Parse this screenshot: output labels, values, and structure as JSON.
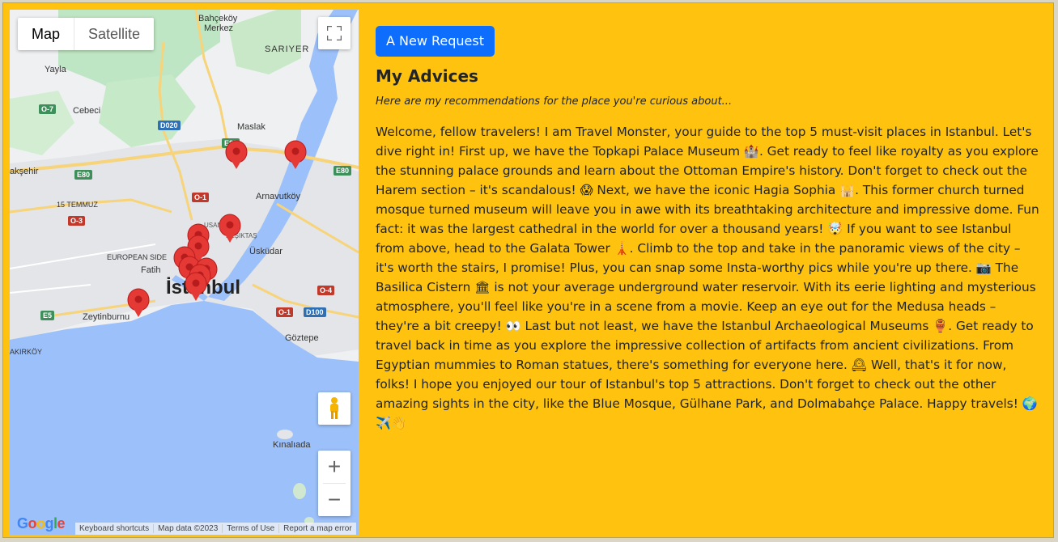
{
  "map": {
    "type_control": {
      "map_label": "Map",
      "satellite_label": "Satellite"
    },
    "fullscreen_icon": "fullscreen-icon",
    "pegman_icon": "pegman-icon",
    "zoom_in_label": "+",
    "zoom_out_label": "−",
    "google_logo": "Google",
    "attribution": {
      "shortcuts": "Keyboard shortcuts",
      "map_data": "Map data ©2023",
      "terms": "Terms of Use",
      "report": "Report a map error"
    },
    "labels": {
      "bahcekoy": "Bahçeköy",
      "merkez": "Merkez",
      "sariyer": "SARIYER",
      "yayla": "Yayla",
      "cebeci": "Cebeci",
      "maslak": "Maslak",
      "aksehir": "akşehir",
      "temmuz": "15 TEMMUZ",
      "arnavutkoy": "Arnavutköy",
      "european_side": "EUROPEAN SIDE",
      "fatih": "Fatih",
      "besiktas": "BEŞIKTAŞ",
      "uskudar": "Üsküdar",
      "istanbul": "İstanbul",
      "zeytinburnu": "Zeytinburnu",
      "goztepe": "Göztepe",
      "bakirkoy": "AKIRKÖY",
      "kinaliada": "Kınalıada",
      "usan": "USAN"
    },
    "shields": {
      "o7": "O-7",
      "d020": "D020",
      "e80a": "E80",
      "e80b": "E80",
      "e80c": "E80",
      "o1a": "O-1",
      "o3": "O-3",
      "e5": "E5",
      "o1b": "O-1",
      "d100": "D100",
      "o4": "O-4"
    },
    "marker_color": "#e53935"
  },
  "panel": {
    "button_label": "A New Request",
    "heading": "My Advices",
    "subtitle": "Here are my recommendations for the place you're curious about...",
    "advice": "Welcome, fellow travelers! I am Travel Monster, your guide to the top 5 must-visit places in Istanbul. Let's dive right in! First up, we have the Topkapi Palace Museum 🏰. Get ready to feel like royalty as you explore the stunning palace grounds and learn about the Ottoman Empire's history. Don't forget to check out the Harem section – it's scandalous! 😱 Next, we have the iconic Hagia Sophia 🕌. This former church turned mosque turned museum will leave you in awe with its breathtaking architecture and impressive dome. Fun fact: it was the largest cathedral in the world for over a thousand years! 🤯 If you want to see Istanbul from above, head to the Galata Tower 🗼. Climb to the top and take in the panoramic views of the city – it's worth the stairs, I promise! Plus, you can snap some Insta-worthy pics while you're up there. 📷 The Basilica Cistern 🏛 is not your average underground water reservoir. With its eerie lighting and mysterious atmosphere, you'll feel like you're in a scene from a movie. Keep an eye out for the Medusa heads – they're a bit creepy! 👀 Last but not least, we have the Istanbul Archaeological Museums 🏺. Get ready to travel back in time as you explore the impressive collection of artifacts from ancient civilizations. From Egyptian mummies to Roman statues, there's something for everyone here. 🕰 Well, that's it for now, folks! I hope you enjoyed our tour of Istanbul's top 5 attractions. Don't forget to check out the other amazing sights in the city, like the Blue Mosque, Gülhane Park, and Dolmabahçe Palace. Happy travels! 🌍✈️👋"
  }
}
